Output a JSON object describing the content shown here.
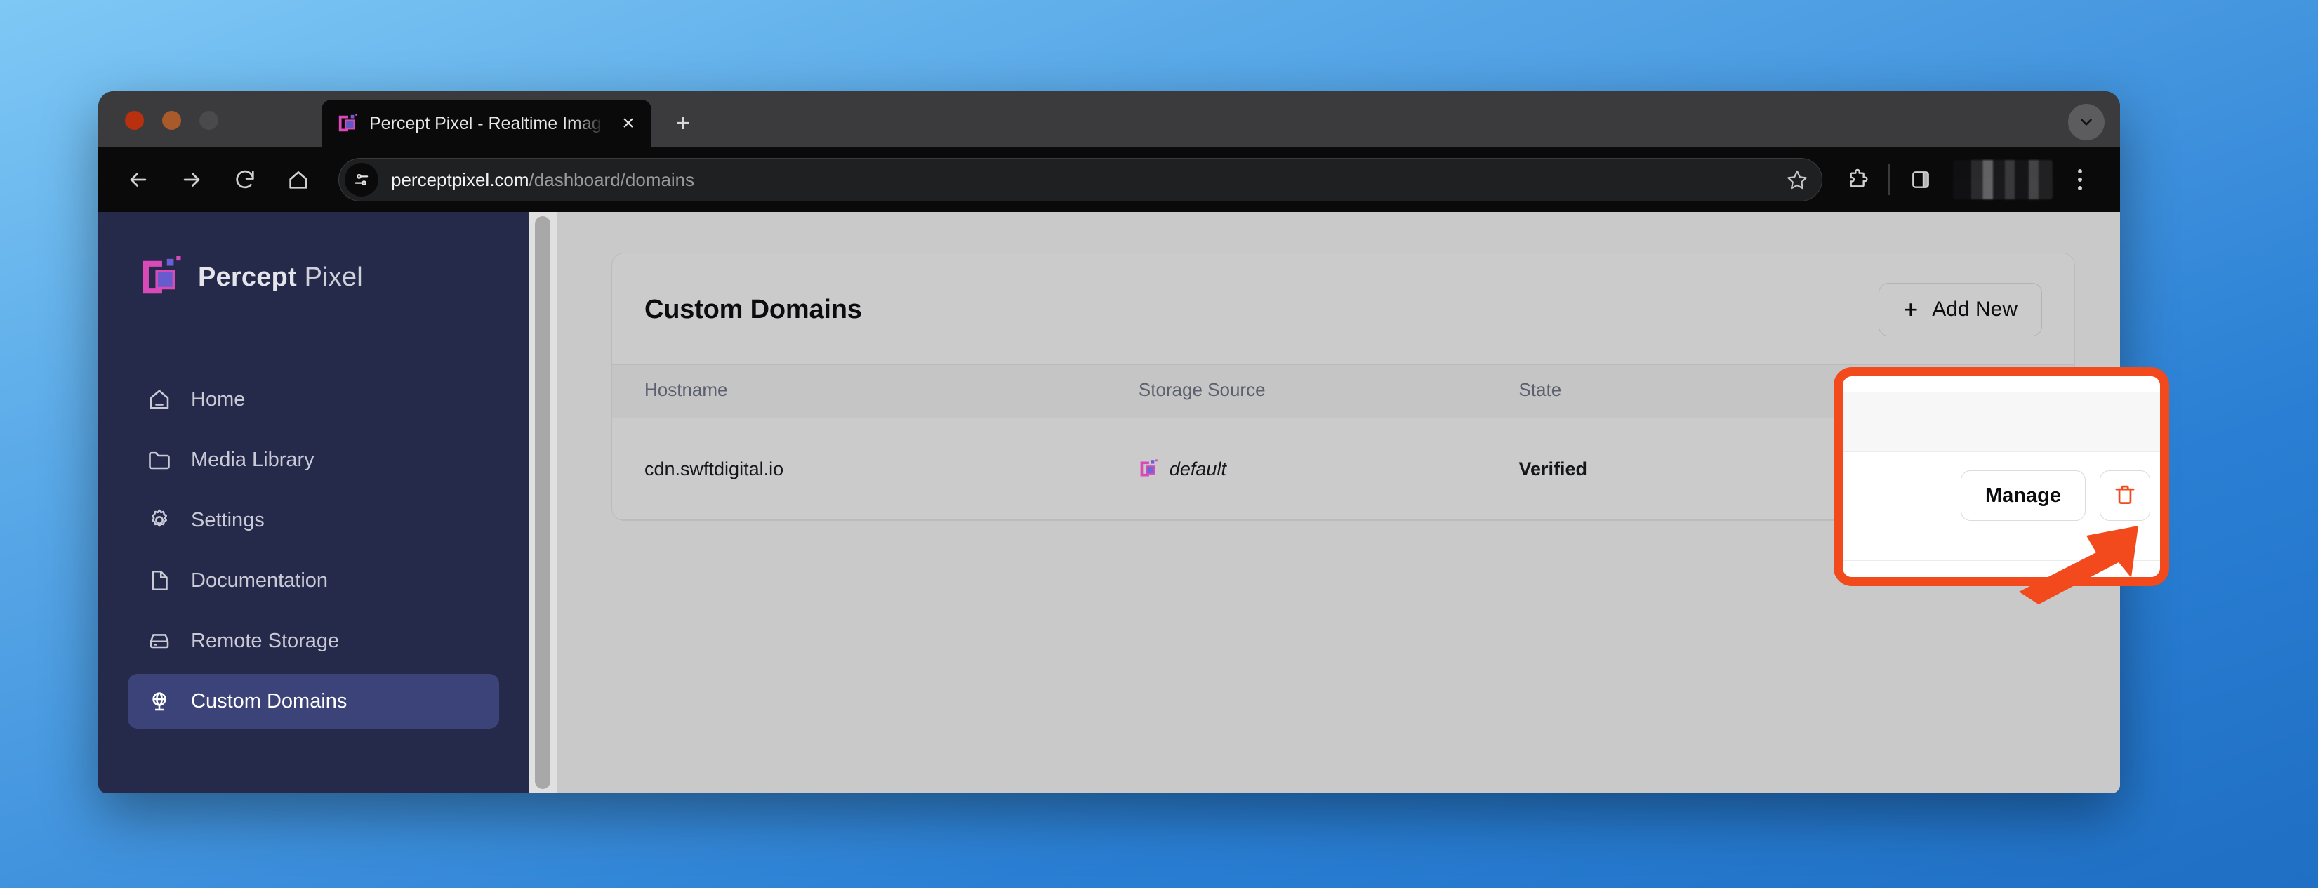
{
  "browser": {
    "tab": {
      "title": "Percept Pixel - Realtime Imag",
      "favicon": "percept-pixel-logo-icon",
      "close_label": "×"
    },
    "new_tab_label": "+",
    "nav": {
      "back": "←",
      "forward": "→",
      "reload": "⟳",
      "home": "⌂"
    },
    "omnibox": {
      "site_settings_icon": "tune-icon",
      "url_domain": "perceptpixel.com",
      "url_path": "/dashboard/domains",
      "bookmark_icon": "star-icon"
    },
    "toolbar_icons": {
      "extensions": "puzzle-icon",
      "side_panel": "side-panel-icon",
      "profile": "profile-avatar",
      "menu": "three-dot-menu-icon"
    },
    "window_controls": {
      "close": "close-traffic-light",
      "minimize": "minimize-traffic-light",
      "maximize": "maximize-traffic-light"
    }
  },
  "sidebar": {
    "brand": {
      "bold": "Percept",
      "regular": "Pixel"
    },
    "items": [
      {
        "label": "Home",
        "icon": "home-icon",
        "active": false
      },
      {
        "label": "Media Library",
        "icon": "folder-icon",
        "active": false
      },
      {
        "label": "Settings",
        "icon": "gear-icon",
        "active": false
      },
      {
        "label": "Documentation",
        "icon": "document-icon",
        "active": false
      },
      {
        "label": "Remote Storage",
        "icon": "hard-drive-icon",
        "active": false
      },
      {
        "label": "Custom Domains",
        "icon": "globe-icon",
        "active": true
      }
    ]
  },
  "main": {
    "card_title": "Custom Domains",
    "add_button": {
      "plus": "+",
      "label": "Add New"
    },
    "table": {
      "columns": [
        "Hostname",
        "Storage Source",
        "State",
        ""
      ],
      "rows": [
        {
          "hostname": "cdn.swftdigital.io",
          "storage_source": "default",
          "storage_source_icon": "percept-pixel-logo-icon",
          "state": "Verified",
          "manage_label": "Manage",
          "delete_icon": "trash-icon"
        }
      ]
    }
  },
  "annotation": {
    "highlight_color": "#f24a1d",
    "shape": "rounded-rectangle",
    "pointer": "arrow-up-right",
    "target": "delete-domain-button"
  },
  "colors": {
    "sidebar_bg": "#252a4a",
    "sidebar_active": "#3b4379",
    "brand_pink": "#d94ab8",
    "brand_purple": "#6a5fd4",
    "accent_red": "#f24a1d",
    "page_bg": "#c9c9c9",
    "desktop_blue": "#2a7fd4"
  }
}
